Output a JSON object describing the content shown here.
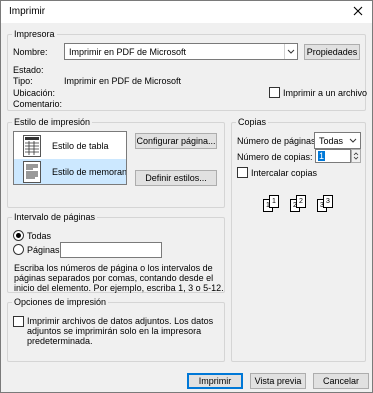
{
  "window": {
    "title": "Imprimir"
  },
  "printer": {
    "group_label": "Impresora",
    "name_label": "Nombre:",
    "name_value": "Imprimir en PDF de Microsoft",
    "properties_button": "Propiedades",
    "status_label": "Estado:",
    "type_label": "Tipo:",
    "type_value": "Imprimir en PDF de Microsoft",
    "location_label": "Ubicación:",
    "comment_label": "Comentario:",
    "print_to_file_label": "Imprimir a un archivo",
    "print_to_file_checked": false
  },
  "print_style": {
    "group_label": "Estilo de impresión",
    "items": [
      {
        "label": "Estilo de tabla",
        "selected": false,
        "icon": "table-style-icon"
      },
      {
        "label": "Estilo de memorando",
        "selected": true,
        "icon": "memo-style-icon"
      }
    ],
    "configure_page_button": "Configurar página...",
    "define_styles_button": "Definir estilos..."
  },
  "copies": {
    "group_label": "Copias",
    "pages_label": "Número de páginas:",
    "pages_value": "Todas",
    "copies_label": "Número de copias:",
    "copies_value": "1",
    "collate_label": "Intercalar copias",
    "collate_checked": false,
    "collate_illustration": [
      [
        "1",
        "1"
      ],
      [
        "2",
        "2"
      ],
      [
        "3",
        "3"
      ]
    ]
  },
  "page_range": {
    "group_label": "Intervalo de páginas",
    "all_label": "Todas",
    "all_selected": true,
    "pages_label": "Páginas:",
    "pages_value": "",
    "help_text": "Escriba los números de página o los intervalos de páginas separados por comas, contando desde el inicio del elemento.  Por ejemplo, escriba 1, 3 o 5-12."
  },
  "print_options": {
    "group_label": "Opciones de impresión",
    "attachments_label": "Imprimir archivos de datos adjuntos. Los datos adjuntos se imprimirán solo en la impresora predeterminada.",
    "attachments_checked": false
  },
  "buttons": {
    "print": "Imprimir",
    "preview": "Vista previa",
    "cancel": "Cancelar"
  }
}
